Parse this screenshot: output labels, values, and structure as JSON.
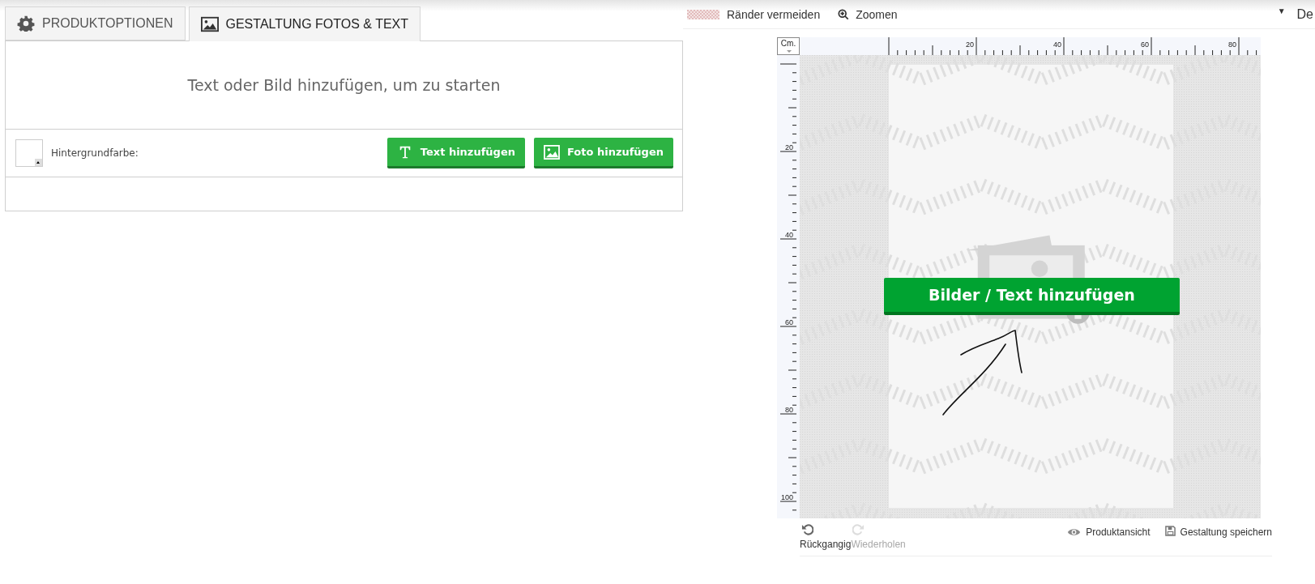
{
  "tabs": [
    {
      "label": "PRODUKTOPTIONEN",
      "selected": false
    },
    {
      "label": "GESTALTUNG FOTOS & TEXT",
      "selected": true
    }
  ],
  "intro": "Text oder Bild hinzufügen, um zu starten",
  "background_color": {
    "label": "Hintergrundfarbe:"
  },
  "buttons": [
    {
      "label": "Text hinzufügen"
    },
    {
      "label": "Foto hinzufügen"
    }
  ],
  "toolbar": {
    "items": [
      {
        "label": "Ränder vermeiden"
      },
      {
        "label": "Zoomen"
      }
    ],
    "dropdown": {
      "caret": "▼",
      "label": "De"
    }
  },
  "ruler": {
    "unit": "Cm.",
    "x_labels": [
      "20",
      "40",
      "60",
      "80"
    ],
    "y_labels": [
      "20",
      "40",
      "60",
      "80",
      "100"
    ]
  },
  "canvas": {
    "button": "Bilder / Text hinzufügen"
  },
  "footer": {
    "history": [
      {
        "label": "Rückgangig",
        "disabled": false
      },
      {
        "label": "Wiederholen",
        "disabled": true
      }
    ],
    "actions": [
      {
        "label": "Produktansicht"
      },
      {
        "label": "Gestaltung speichern"
      }
    ]
  }
}
